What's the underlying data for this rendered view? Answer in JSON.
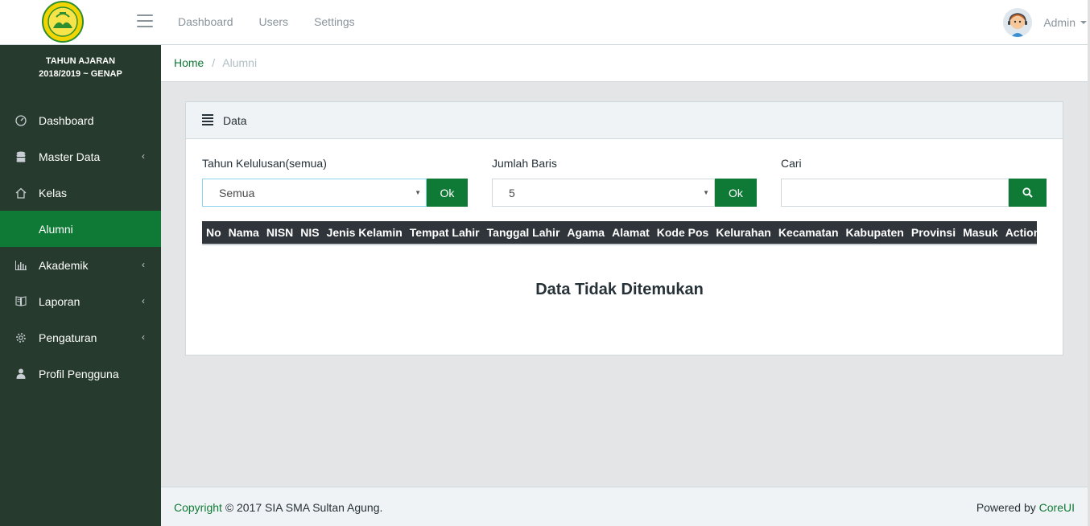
{
  "header": {
    "nav": [
      "Dashboard",
      "Users",
      "Settings"
    ],
    "user_label": "Admin"
  },
  "sidebar": {
    "year_title": "TAHUN AJARAN",
    "year_value": "2018/2019 ~ GENAP",
    "items": [
      {
        "label": "Dashboard",
        "icon": "speedometer-icon"
      },
      {
        "label": "Master Data",
        "icon": "database-icon",
        "arrow": "‹"
      },
      {
        "label": "Kelas",
        "icon": "home-icon"
      },
      {
        "label": "Alumni",
        "icon": "",
        "active": true
      },
      {
        "label": "Akademik",
        "icon": "bar-chart-icon",
        "arrow": "‹"
      },
      {
        "label": "Laporan",
        "icon": "book-icon",
        "arrow": "‹"
      },
      {
        "label": "Pengaturan",
        "icon": "gear-icon",
        "arrow": "‹"
      },
      {
        "label": "Profil Pengguna",
        "icon": "user-icon"
      }
    ]
  },
  "breadcrumb": {
    "home": "Home",
    "separator": "/",
    "current": "Alumni"
  },
  "card": {
    "title": "Data",
    "filters": {
      "tahun_label": "Tahun Kelulusan(semua)",
      "tahun_value": "Semua",
      "jumlah_label": "Jumlah Baris",
      "jumlah_value": "5",
      "cari_label": "Cari",
      "ok_label": "Ok"
    },
    "columns": [
      "No",
      "Nama",
      "NISN",
      "NIS",
      "Jenis Kelamin",
      "Tempat Lahir",
      "Tanggal Lahir",
      "Agama",
      "Alamat",
      "Kode Pos",
      "Kelurahan",
      "Kecamatan",
      "Kabupaten",
      "Provinsi",
      "Masuk",
      "Action"
    ],
    "empty_message": "Data Tidak Ditemukan"
  },
  "footer": {
    "copyright_link": "Copyright",
    "copyright_text": "© 2017 SIA SMA Sultan Agung.",
    "powered_text": "Powered by",
    "powered_link": "CoreUI"
  },
  "colors": {
    "brand_green": "#0f7a36",
    "sidebar_bg": "#263a2d",
    "table_head_bg": "#2f353a"
  }
}
